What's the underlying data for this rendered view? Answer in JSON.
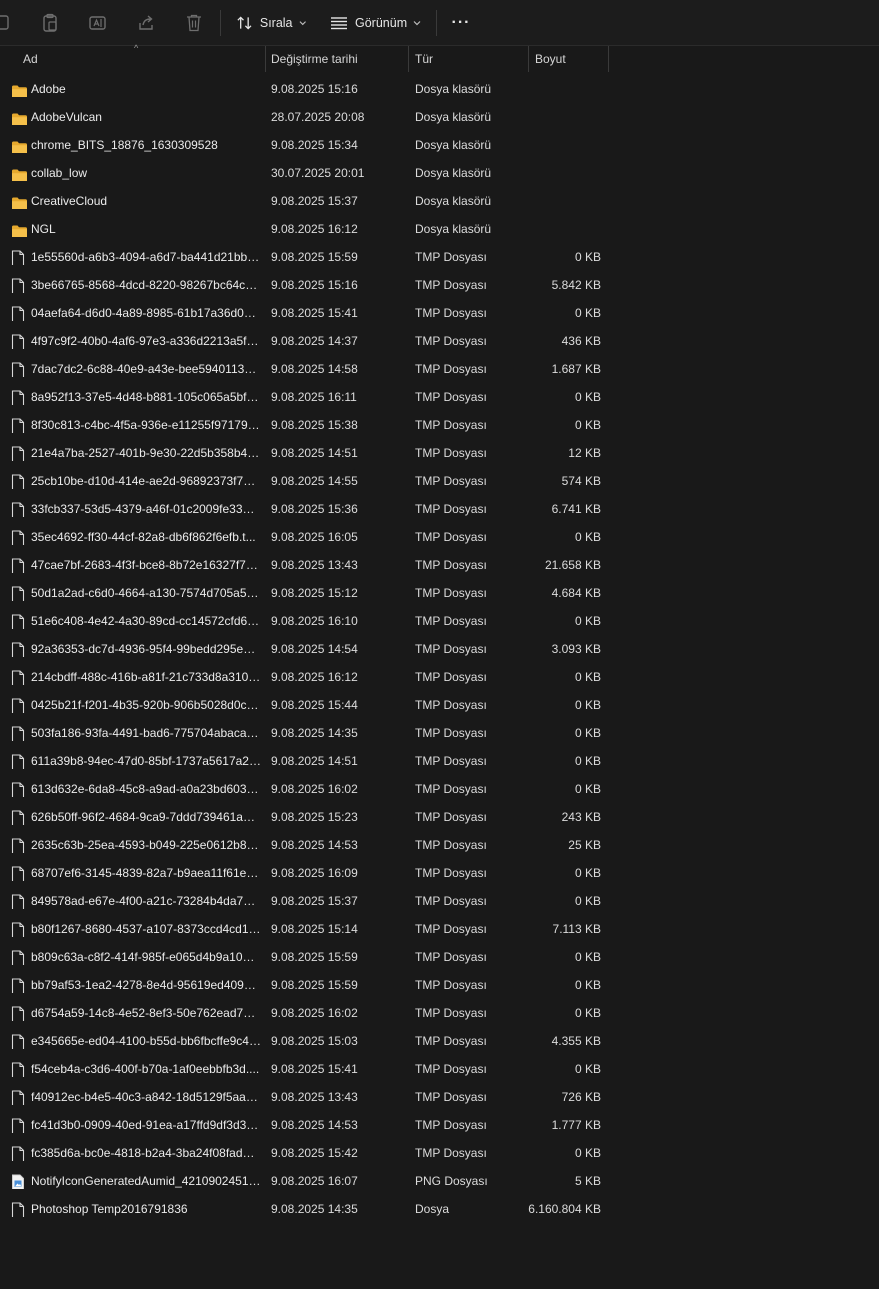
{
  "toolbar": {
    "sort_label": "Sırala",
    "view_label": "Görünüm",
    "more_label": "···"
  },
  "columns": {
    "name": "Ad",
    "date": "Değiştirme tarihi",
    "type": "Tür",
    "size": "Boyut"
  },
  "files": [
    {
      "icon": "folder-icon",
      "name": "Adobe",
      "date": "9.08.2025 15:16",
      "type": "Dosya klasörü",
      "size": ""
    },
    {
      "icon": "folder-icon",
      "name": "AdobeVulcan",
      "date": "28.07.2025 20:08",
      "type": "Dosya klasörü",
      "size": ""
    },
    {
      "icon": "folder-icon",
      "name": "chrome_BITS_18876_1630309528",
      "date": "9.08.2025 15:34",
      "type": "Dosya klasörü",
      "size": ""
    },
    {
      "icon": "folder-icon",
      "name": "collab_low",
      "date": "30.07.2025 20:01",
      "type": "Dosya klasörü",
      "size": ""
    },
    {
      "icon": "folder-icon",
      "name": "CreativeCloud",
      "date": "9.08.2025 15:37",
      "type": "Dosya klasörü",
      "size": ""
    },
    {
      "icon": "folder-icon",
      "name": "NGL",
      "date": "9.08.2025 16:12",
      "type": "Dosya klasörü",
      "size": ""
    },
    {
      "icon": "file-icon",
      "name": "1e55560d-a6b3-4094-a6d7-ba441d21bbc...",
      "date": "9.08.2025 15:59",
      "type": "TMP Dosyası",
      "size": "0 KB"
    },
    {
      "icon": "file-icon",
      "name": "3be66765-8568-4dcd-8220-98267bc64c16...",
      "date": "9.08.2025 15:16",
      "type": "TMP Dosyası",
      "size": "5.842 KB"
    },
    {
      "icon": "file-icon",
      "name": "04aefa64-d6d0-4a89-8985-61b17a36d088...",
      "date": "9.08.2025 15:41",
      "type": "TMP Dosyası",
      "size": "0 KB"
    },
    {
      "icon": "file-icon",
      "name": "4f97c9f2-40b0-4af6-97e3-a336d2213a5f.t...",
      "date": "9.08.2025 14:37",
      "type": "TMP Dosyası",
      "size": "436 KB"
    },
    {
      "icon": "file-icon",
      "name": "7dac7dc2-6c88-40e9-a43e-bee59401139e...",
      "date": "9.08.2025 14:58",
      "type": "TMP Dosyası",
      "size": "1.687 KB"
    },
    {
      "icon": "file-icon",
      "name": "8a952f13-37e5-4d48-b881-105c065a5bf7....",
      "date": "9.08.2025 16:11",
      "type": "TMP Dosyası",
      "size": "0 KB"
    },
    {
      "icon": "file-icon",
      "name": "8f30c813-c4bc-4f5a-936e-e11255f97179.t...",
      "date": "9.08.2025 15:38",
      "type": "TMP Dosyası",
      "size": "0 KB"
    },
    {
      "icon": "file-icon",
      "name": "21e4a7ba-2527-401b-9e30-22d5b358b405...",
      "date": "9.08.2025 14:51",
      "type": "TMP Dosyası",
      "size": "12 KB"
    },
    {
      "icon": "file-icon",
      "name": "25cb10be-d10d-414e-ae2d-96892373f7b3...",
      "date": "9.08.2025 14:55",
      "type": "TMP Dosyası",
      "size": "574 KB"
    },
    {
      "icon": "file-icon",
      "name": "33fcb337-53d5-4379-a46f-01c2009fe332.t...",
      "date": "9.08.2025 15:36",
      "type": "TMP Dosyası",
      "size": "6.741 KB"
    },
    {
      "icon": "file-icon",
      "name": "35ec4692-ff30-44cf-82a8-db6f862f6efb.t...",
      "date": "9.08.2025 16:05",
      "type": "TMP Dosyası",
      "size": "0 KB"
    },
    {
      "icon": "file-icon",
      "name": "47cae7bf-2683-4f3f-bce8-8b72e16327f7.t...",
      "date": "9.08.2025 13:43",
      "type": "TMP Dosyası",
      "size": "21.658 KB"
    },
    {
      "icon": "file-icon",
      "name": "50d1a2ad-c6d0-4664-a130-7574d705a5c6...",
      "date": "9.08.2025 15:12",
      "type": "TMP Dosyası",
      "size": "4.684 KB"
    },
    {
      "icon": "file-icon",
      "name": "51e6c408-4e42-4a30-89cd-cc14572cfd67....",
      "date": "9.08.2025 16:10",
      "type": "TMP Dosyası",
      "size": "0 KB"
    },
    {
      "icon": "file-icon",
      "name": "92a36353-dc7d-4936-95f4-99bedd295e97...",
      "date": "9.08.2025 14:54",
      "type": "TMP Dosyası",
      "size": "3.093 KB"
    },
    {
      "icon": "file-icon",
      "name": "214cbdff-488c-416b-a81f-21c733d8a310.t...",
      "date": "9.08.2025 16:12",
      "type": "TMP Dosyası",
      "size": "0 KB"
    },
    {
      "icon": "file-icon",
      "name": "0425b21f-f201-4b35-920b-906b5028d0c5...",
      "date": "9.08.2025 15:44",
      "type": "TMP Dosyası",
      "size": "0 KB"
    },
    {
      "icon": "file-icon",
      "name": "503fa186-93fa-4491-bad6-775704abacab....",
      "date": "9.08.2025 14:35",
      "type": "TMP Dosyası",
      "size": "0 KB"
    },
    {
      "icon": "file-icon",
      "name": "611a39b8-94ec-47d0-85bf-1737a5617a23....",
      "date": "9.08.2025 14:51",
      "type": "TMP Dosyası",
      "size": "0 KB"
    },
    {
      "icon": "file-icon",
      "name": "613d632e-6da8-45c8-a9ad-a0a23bd60384...",
      "date": "9.08.2025 16:02",
      "type": "TMP Dosyası",
      "size": "0 KB"
    },
    {
      "icon": "file-icon",
      "name": "626b50ff-96f2-4684-9ca9-7ddd739461a2.t...",
      "date": "9.08.2025 15:23",
      "type": "TMP Dosyası",
      "size": "243 KB"
    },
    {
      "icon": "file-icon",
      "name": "2635c63b-25ea-4593-b049-225e0612b89f....",
      "date": "9.08.2025 14:53",
      "type": "TMP Dosyası",
      "size": "25 KB"
    },
    {
      "icon": "file-icon",
      "name": "68707ef6-3145-4839-82a7-b9aea11f61e1.t...",
      "date": "9.08.2025 16:09",
      "type": "TMP Dosyası",
      "size": "0 KB"
    },
    {
      "icon": "file-icon",
      "name": "849578ad-e67e-4f00-a21c-73284b4da736....",
      "date": "9.08.2025 15:37",
      "type": "TMP Dosyası",
      "size": "0 KB"
    },
    {
      "icon": "file-icon",
      "name": "b80f1267-8680-4537-a107-8373ccd4cd16....",
      "date": "9.08.2025 15:14",
      "type": "TMP Dosyası",
      "size": "7.113 KB"
    },
    {
      "icon": "file-icon",
      "name": "b809c63a-c8f2-414f-985f-e065d4b9a106.t...",
      "date": "9.08.2025 15:59",
      "type": "TMP Dosyası",
      "size": "0 KB"
    },
    {
      "icon": "file-icon",
      "name": "bb79af53-1ea2-4278-8e4d-95619ed40991....",
      "date": "9.08.2025 15:59",
      "type": "TMP Dosyası",
      "size": "0 KB"
    },
    {
      "icon": "file-icon",
      "name": "d6754a59-14c8-4e52-8ef3-50e762ead741....",
      "date": "9.08.2025 16:02",
      "type": "TMP Dosyası",
      "size": "0 KB"
    },
    {
      "icon": "file-icon",
      "name": "e345665e-ed04-4100-b55d-bb6fbcffe9c4....",
      "date": "9.08.2025 15:03",
      "type": "TMP Dosyası",
      "size": "4.355 KB"
    },
    {
      "icon": "file-icon",
      "name": "f54ceb4a-c3d6-400f-b70a-1af0eebbfb3d....",
      "date": "9.08.2025 15:41",
      "type": "TMP Dosyası",
      "size": "0 KB"
    },
    {
      "icon": "file-icon",
      "name": "f40912ec-b4e5-40c3-a842-18d5129f5aa6.t...",
      "date": "9.08.2025 13:43",
      "type": "TMP Dosyası",
      "size": "726 KB"
    },
    {
      "icon": "file-icon",
      "name": "fc41d3b0-0909-40ed-91ea-a17ffd9df3d3.t...",
      "date": "9.08.2025 14:53",
      "type": "TMP Dosyası",
      "size": "1.777 KB"
    },
    {
      "icon": "file-icon",
      "name": "fc385d6a-bc0e-4818-b2a4-3ba24f08fad2....",
      "date": "9.08.2025 15:42",
      "type": "TMP Dosyası",
      "size": "0 KB"
    },
    {
      "icon": "png-file-icon",
      "name": "NotifyIconGeneratedAumid_42109024513...",
      "date": "9.08.2025 16:07",
      "type": "PNG Dosyası",
      "size": "5 KB"
    },
    {
      "icon": "file-icon",
      "name": "Photoshop Temp2016791836",
      "date": "9.08.2025 14:35",
      "type": "Dosya",
      "size": "6.160.804 KB"
    }
  ],
  "colors": {
    "background": "#191919",
    "folder": "#f5c04a",
    "text": "#ececec"
  }
}
